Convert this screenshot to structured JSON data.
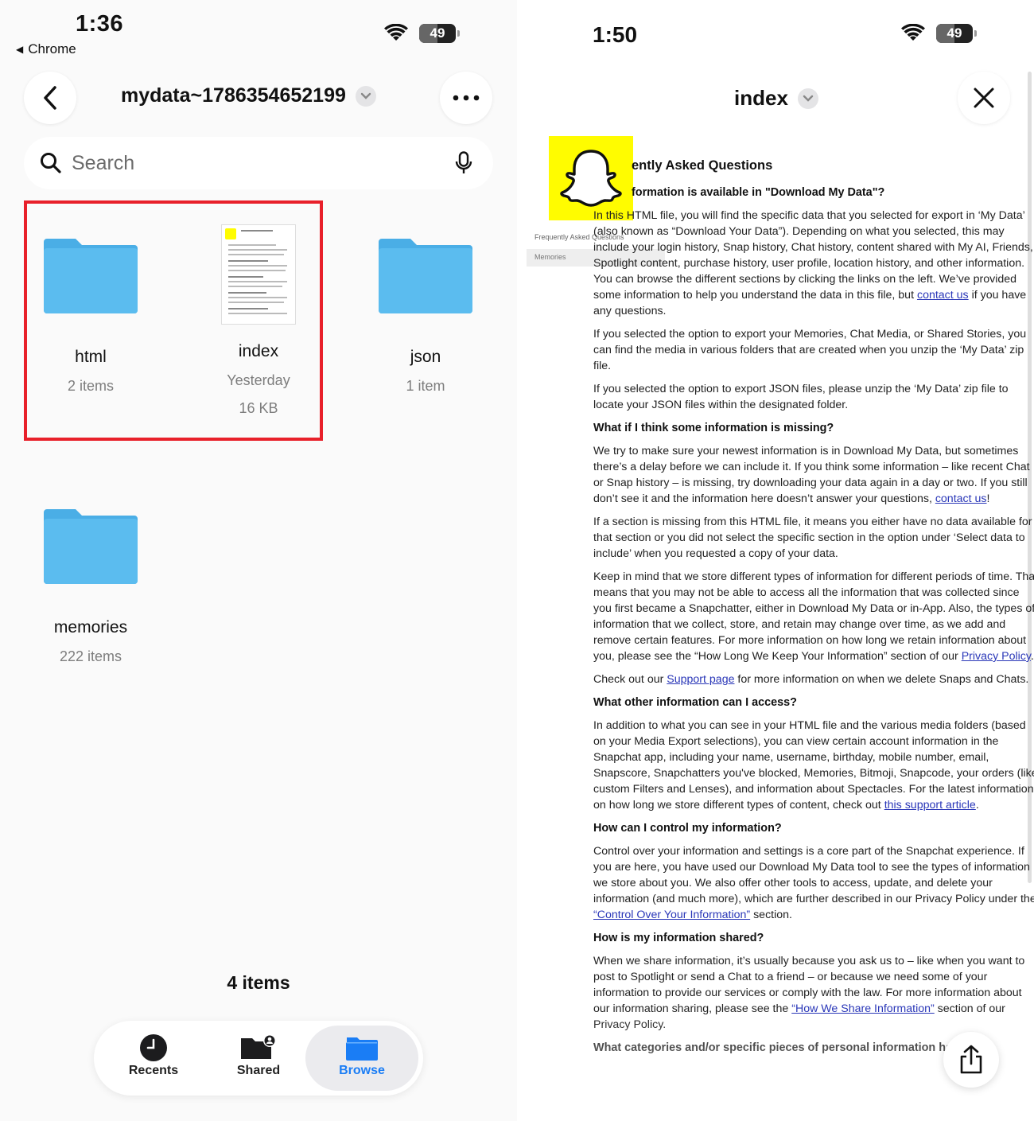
{
  "left": {
    "status": {
      "time": "1:36",
      "back_app": "Chrome",
      "battery": "49",
      "battery_level": 0.49
    },
    "header": {
      "folder_title": "mydata~1786354652199"
    },
    "search": {
      "placeholder": "Search"
    },
    "items": [
      {
        "name": "html",
        "meta": "2 items"
      },
      {
        "name": "index",
        "meta": "Yesterday",
        "meta2": "16 KB"
      },
      {
        "name": "json",
        "meta": "1 item"
      },
      {
        "name": "memories",
        "meta": "222 items"
      }
    ],
    "count": "4 items",
    "tabs": [
      {
        "label": "Recents",
        "icon": "clock-icon"
      },
      {
        "label": "Shared",
        "icon": "shared-folder-icon"
      },
      {
        "label": "Browse",
        "icon": "folder-icon"
      }
    ],
    "colors": {
      "folder": "#5bbcef",
      "highlight": "#e8202a",
      "accent": "#1a7df5"
    }
  },
  "right": {
    "status": {
      "time": "1:50",
      "battery": "49",
      "battery_level": 0.49
    },
    "title": "index",
    "sidebar": {
      "faq": "Frequently Asked Questions",
      "memories": "Memories"
    },
    "doc": {
      "heading": "ently Asked Questions",
      "q_available": "formation is available in \"Download My Data\"?",
      "p1a": "In this HTML file, you will find the specific data that you selected for export in ‘My Data’ (also known as “Download Your Data”). Depending on what you selected, this may include your login history, Snap history, Chat history, content shared with My AI, Friends, Spotlight content, purchase history, user profile, location history, and other information. You can browse the different sections by clicking the links on the left. We’ve provided some information to help you understand the data in this file, but",
      "p1_link": "contact us",
      "p1b": " if you have any questions.",
      "p2": "If you selected the option to export your Memories, Chat Media, or Shared Stories, you can find the media in various folders that are created when you unzip the ‘My Data’ zip file.",
      "p3": "If you selected the option to export JSON files, please unzip the ‘My Data’ zip file to locate your JSON files within the designated folder.",
      "q_missing": "What if I think some information is missing?",
      "p4a": "We try to make sure your newest information is in Download My Data, but sometimes there’s a delay before we can include it. If you think some information – like recent Chat or Snap history – is missing, try downloading your data again in a day or two. If you still don’t see it and the information here doesn’t answer your questions, ",
      "p4_link": "contact us",
      "p4b": "!",
      "p5": "If a section is missing from this HTML file, it means you either have no data available for that section or you did not select the specific section in the option under ‘Select data to include’ when you requested a copy of your data.",
      "p6a": "Keep in mind that we store different types of information for different periods of time. That means that you may not be able to access all the information that was collected since you first became a Snapchatter, either in Download My Data or in-App. Also, the types of information that we collect, store, and retain may change over time, as we add and remove certain features. For more information on how long we retain information about you, please see the “How Long We Keep Your Information” section of our ",
      "p6_link": "Privacy Policy",
      "p6b": ".",
      "p7a": "Check out our ",
      "p7_link": "Support page",
      "p7b": " for more information on when we delete Snaps and Chats.",
      "q_other": "What other information can I access?",
      "p8a": "In addition to what you can see in your HTML file and the various media folders (based on your Media Export selections), you can view certain account information in the Snapchat app, including your name, username, birthday, mobile number, email, Snapscore, Snapchatters you've blocked, Memories, Bitmoji, Snapcode, your orders (like custom Filters and Lenses), and information about Spectacles. For the latest information on how long we store different types of content, check out ",
      "p8_link": "this support article",
      "p8b": ".",
      "q_control": "How can I control my information?",
      "p9a": "Control over your information and settings is a core part of the Snapchat experience. If you are here, you have used our Download My Data tool to see the types of information we store about you. We also offer other tools to access, update, and delete your information (and much more), which are further described in our Privacy Policy under the ",
      "p9_link": "“Control Over Your Information”",
      "p9b": " section.",
      "q_shared": "How is my information shared?",
      "p10a": "When we share information, it’s usually because you ask us to – like when you want to post to Spotlight or send a Chat to a friend – or because we need some of your information to provide our services or comply with the law. For more information about our information sharing, please see the ",
      "p10_link": "“How We Share Information”",
      "p10b": " section of our Privacy Policy.",
      "q_categories": "What categories and/or specific pieces of personal information has Snap"
    }
  }
}
